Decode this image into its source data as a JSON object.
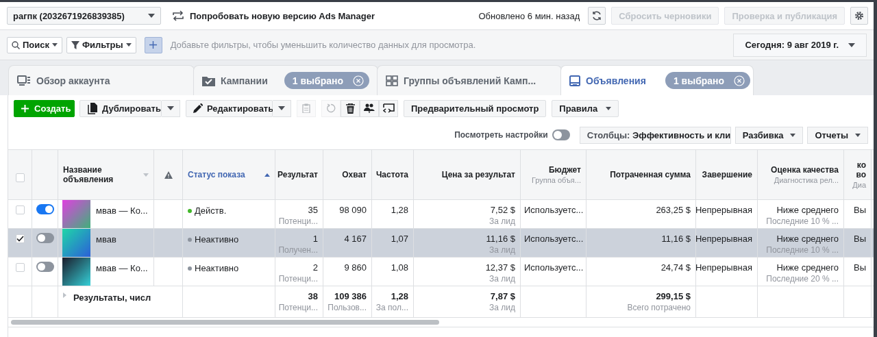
{
  "account_selector": {
    "label": "рагпк (2032671926839385)"
  },
  "try_new_version": {
    "label": "Попробовать новую версию Ads Manager"
  },
  "updated_text": "Обновлено 6 мин. назад",
  "header_buttons": [
    {
      "label": "Сбросить черновики",
      "disabled": true
    },
    {
      "label": "Проверка и публикация",
      "disabled": true
    }
  ],
  "filter_bar": {
    "search": "Поиск",
    "filters": "Фильтры",
    "hint": "Добавьте фильтры, чтобы уменьшить количество данных для просмотра.",
    "date": "Сегодня: 9 авг 2019 г."
  },
  "tabs": [
    {
      "label": "Обзор аккаунта",
      "selected": false
    },
    {
      "label": "Кампании",
      "selected": false,
      "badge": "1 выбрано"
    },
    {
      "label": "Группы объявлений Камп...",
      "selected": false
    },
    {
      "label": "Объявления",
      "selected": true,
      "badge": "1 выбрано"
    }
  ],
  "toolbar": {
    "create": "Создать",
    "duplicate": "Дублировать",
    "edit": "Редактировать",
    "icon_buttons": [
      {
        "disabled": true
      },
      {
        "disabled": true
      },
      {
        "disabled": false
      },
      {
        "disabled": false
      },
      {
        "disabled": false
      }
    ],
    "preview": "Предварительный просмотр",
    "rules": "Правила"
  },
  "view_bar": {
    "settings_label": "Посмотреть настройки",
    "settings_on": false,
    "columns_prefix": "Столбцы:",
    "columns_value": "Эффективность и кли",
    "breakdown": "Разбивка",
    "reports": "Отчеты"
  },
  "table": {
    "all_checked": false,
    "columns": [
      {
        "label": "Название объявления",
        "sorted": false
      },
      {
        "kind": "warning"
      },
      {
        "label": "Статус показа",
        "sorted": true
      },
      {
        "label": "Результат"
      },
      {
        "label": "Охват"
      },
      {
        "label": "Частота"
      },
      {
        "label": "Цена за результат"
      },
      {
        "label": "Бюджет",
        "sub": "Группа объя..."
      },
      {
        "label": "Потраченная сумма"
      },
      {
        "label": "Завершение"
      },
      {
        "label": "Оценка качества",
        "sub": "Диагностика рел..."
      },
      {
        "label": "ко во",
        "sub": "Диа"
      }
    ],
    "rows": [
      {
        "selected": false,
        "on": true,
        "cells": [
          {
            "value": "мвав — Ко..."
          },
          null,
          {
            "value": "Действ.",
            "color": "#42b72a"
          },
          {
            "value": "35",
            "sub": "Потенци..."
          },
          {
            "value": "98 090"
          },
          {
            "value": "1,28"
          },
          {
            "value": "7,52 $",
            "sub": "За лид"
          },
          {
            "value": "Используетс..."
          },
          {
            "value": "263,25 $"
          },
          {
            "value": "Непрерывная"
          },
          {
            "value": "Ниже среднего",
            "sub": "Последние 10 % ..."
          },
          {
            "value": "Вы"
          }
        ]
      },
      {
        "selected": true,
        "on": false,
        "cells": [
          {
            "value": "мвав"
          },
          null,
          {
            "value": "Неактивно",
            "color": "#8d949e"
          },
          {
            "value": "1",
            "sub": "Получен..."
          },
          {
            "value": "4 167"
          },
          {
            "value": "1,07"
          },
          {
            "value": "11,16 $",
            "sub": "За лид"
          },
          {
            "value": "Используетс..."
          },
          {
            "value": "11,16 $"
          },
          {
            "value": "Непрерывная"
          },
          {
            "value": "Ниже среднего",
            "sub": "Последние 10 % ..."
          },
          {
            "value": "Вы"
          }
        ]
      },
      {
        "selected": false,
        "on": false,
        "cells": [
          {
            "value": "мвав — Ко..."
          },
          null,
          {
            "value": "Неактивно",
            "color": "#8d949e"
          },
          {
            "value": "2",
            "sub": "Потенци..."
          },
          {
            "value": "9 860"
          },
          {
            "value": "1,08"
          },
          {
            "value": "12,37 $",
            "sub": "За лид"
          },
          {
            "value": "Используетс..."
          },
          {
            "value": "24,74 $"
          },
          {
            "value": "Непрерывная"
          },
          {
            "value": "Ниже среднего",
            "sub": "Последние 20 % ..."
          },
          {
            "value": "Вы"
          }
        ]
      }
    ],
    "totals": {
      "cells": [
        {
          "value": "Результаты, числ"
        },
        null,
        null,
        {
          "value": "38",
          "sub": "Потенци..."
        },
        {
          "value": "109 386",
          "sub": "Пользов..."
        },
        {
          "value": "1,28",
          "sub": "За пол..."
        },
        {
          "value": "7,87 $",
          "sub": "За лид"
        },
        null,
        {
          "value": "299,15 $",
          "sub": "Всего потрачено"
        },
        null,
        null,
        null
      ]
    }
  }
}
